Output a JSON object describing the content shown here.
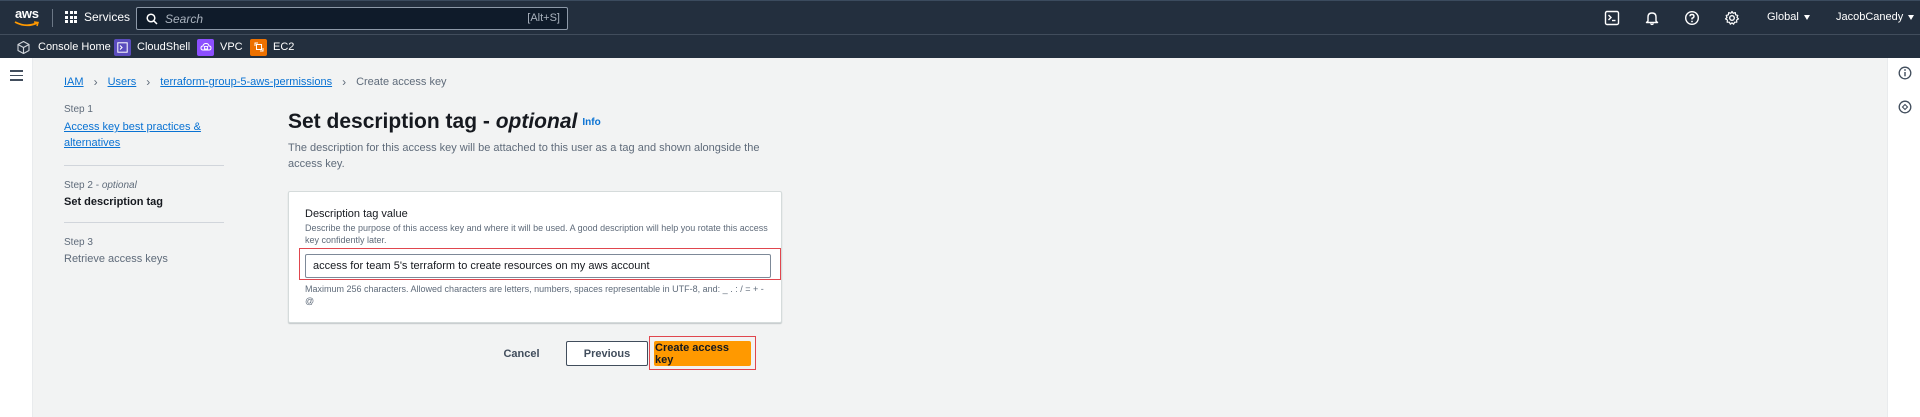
{
  "topnav": {
    "logo_text": "aws",
    "services_label": "Services",
    "search": {
      "placeholder": "Search",
      "shortcut": "[Alt+S]"
    },
    "region_label": "Global",
    "account_label": "JacobCanedy"
  },
  "favorites": [
    {
      "label": "Console Home",
      "color": "#414d5c"
    },
    {
      "label": "CloudShell",
      "color": "#5a4cbd"
    },
    {
      "label": "VPC",
      "color": "#8c4fff"
    },
    {
      "label": "EC2",
      "color": "#ed7100"
    }
  ],
  "breadcrumb": {
    "items": [
      "IAM",
      "Users",
      "terraform-group-5-aws-permissions"
    ],
    "current": "Create access key"
  },
  "wizard": {
    "step1": {
      "label": "Step 1",
      "title": "Access key best practices & alternatives"
    },
    "step2": {
      "label": "Step 2 - ",
      "optional": "optional",
      "title": "Set description tag"
    },
    "step3": {
      "label": "Step 3",
      "title": "Retrieve access keys"
    }
  },
  "main": {
    "title": "Set description tag - ",
    "title_optional": "optional",
    "info_label": "Info",
    "description": "The description for this access key will be attached to this user as a tag and shown alongside the access key.",
    "field_label": "Description tag value",
    "field_description": "Describe the purpose of this access key and where it will be used. A good description will help you rotate this access key confidently later.",
    "field_value": "access for team 5's terraform to create resources on my aws account",
    "constraint": "Maximum 256 characters. Allowed characters are letters, numbers, spaces representable in UTF-8, and: _ . : / = + - @"
  },
  "actions": {
    "cancel": "Cancel",
    "previous": "Previous",
    "create": "Create access key"
  },
  "colors": {
    "nav_bg": "#232f3e",
    "primary": "#ff9900",
    "link": "#0972d3",
    "highlight": "#e0464e"
  }
}
